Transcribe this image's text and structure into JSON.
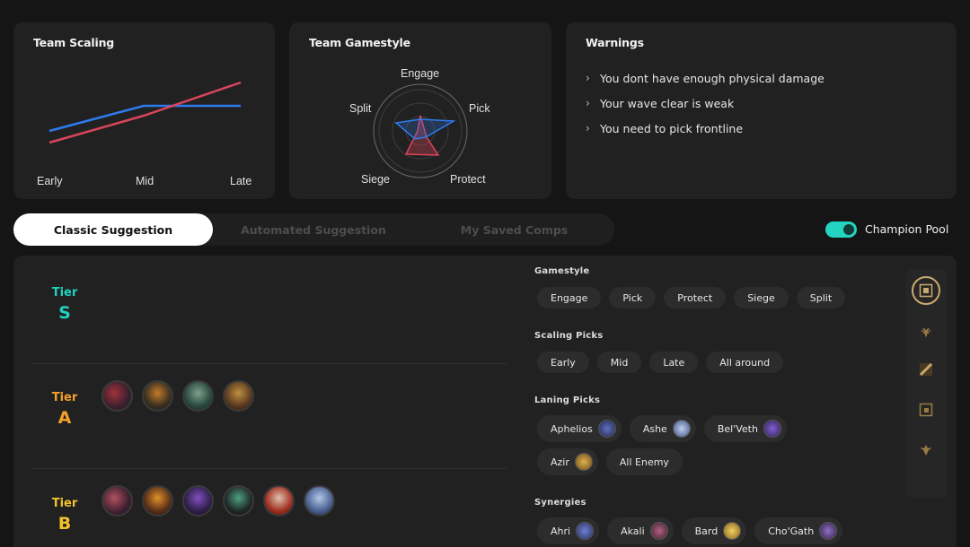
{
  "scaling": {
    "title": "Team Scaling",
    "labels": [
      "Early",
      "Mid",
      "Late"
    ],
    "colors": {
      "blue": "#2e7bf0",
      "red": "#d9455a"
    }
  },
  "gamestyle_card": {
    "title": "Team Gamestyle",
    "axes": [
      "Engage",
      "Pick",
      "Protect",
      "Siege",
      "Split"
    ]
  },
  "warnings": {
    "title": "Warnings",
    "items": [
      "You dont have enough physical damage",
      "Your wave clear is weak",
      "You need to pick frontline"
    ]
  },
  "tabs": {
    "classic": "Classic Suggestion",
    "automated": "Automated Suggestion",
    "saved": "My Saved Comps"
  },
  "champion_pool": {
    "label": "Champion Pool",
    "enabled": true,
    "accent": "#23d5c0"
  },
  "tiers": [
    {
      "word": "Tier",
      "letter": "S",
      "color": "#1fd2c0"
    },
    {
      "word": "Tier",
      "letter": "A",
      "color": "#f3a12a"
    },
    {
      "word": "Tier",
      "letter": "B",
      "color": "#f3c12a"
    }
  ],
  "filters": {
    "gamestyle": {
      "title": "Gamestyle",
      "chips": [
        "Engage",
        "Pick",
        "Protect",
        "Siege",
        "Split"
      ]
    },
    "scaling": {
      "title": "Scaling Picks",
      "chips": [
        "Early",
        "Mid",
        "Late",
        "All around"
      ]
    },
    "laning": {
      "title": "Laning Picks",
      "chips": [
        "Aphelios",
        "Ashe",
        "Bel'Veth",
        "Azir",
        "All Enemy"
      ]
    },
    "synergies": {
      "title": "Synergies",
      "chips": [
        "Ahri",
        "Akali",
        "Bard",
        "Cho'Gath"
      ]
    }
  },
  "role_icons": [
    "top-lane-icon",
    "jungle-icon",
    "mid-lane-icon",
    "bottom-lane-icon",
    "support-icon"
  ]
}
